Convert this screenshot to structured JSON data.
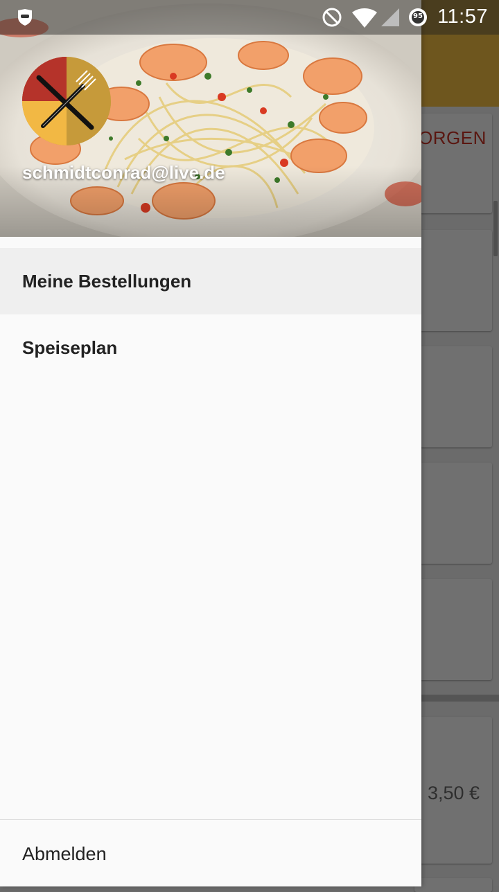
{
  "status_bar": {
    "time": "11:57",
    "battery_level": "95",
    "icons": [
      "app-shield-icon",
      "do-not-disturb-icon",
      "wifi-icon",
      "cell-signal-icon",
      "battery-saver-icon"
    ]
  },
  "background_app": {
    "card_text": "ORGEN",
    "price": "3,50 €",
    "toolbar_color": "#6e561e"
  },
  "drawer": {
    "header": {
      "email": "schmidtconrad@live.de",
      "image": "shrimp-spaghetti-plate"
    },
    "menu_items": [
      {
        "label": "Meine Bestellungen",
        "active": true
      },
      {
        "label": "Speiseplan",
        "active": false
      }
    ],
    "logout_label": "Abmelden"
  },
  "colors": {
    "logo_red": "#b5332a",
    "logo_yellow": "#f2b844",
    "logo_tan": "#c69a3a"
  }
}
